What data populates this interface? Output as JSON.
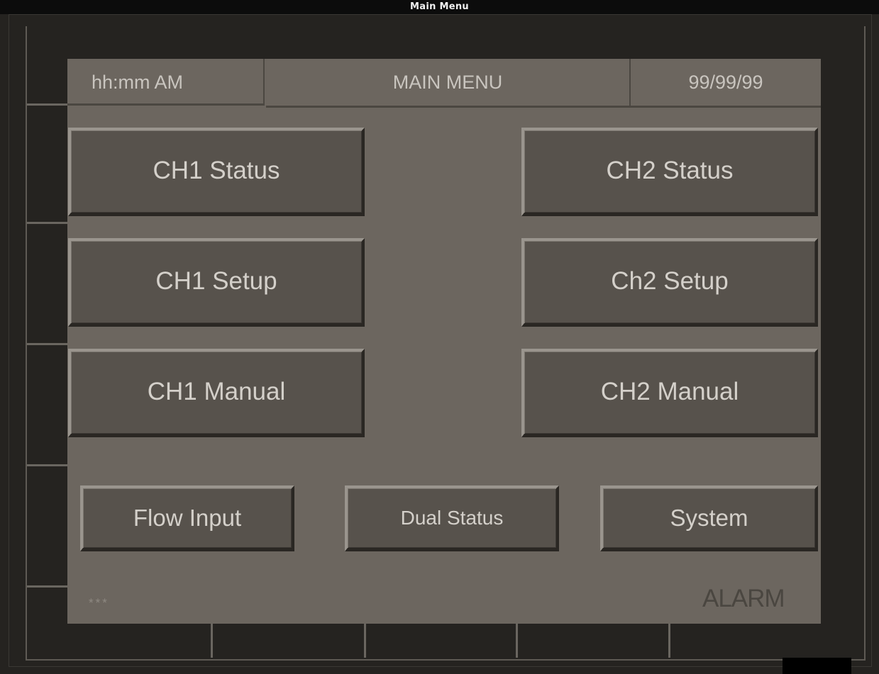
{
  "window": {
    "title": "Main Menu"
  },
  "header": {
    "time": "hh:mm AM",
    "title": "MAIN MENU",
    "date": "99/99/99"
  },
  "buttons": {
    "ch1_status": "CH1 Status",
    "ch2_status": "CH2 Status",
    "ch1_setup": "CH1 Setup",
    "ch2_setup": "Ch2 Setup",
    "ch1_manual": "CH1 Manual",
    "ch2_manual": "CH2 Manual",
    "flow_input": "Flow Input",
    "dual_status": "Dual Status",
    "system": "System"
  },
  "footer": {
    "indicator": "***",
    "alarm": "ALARM"
  }
}
